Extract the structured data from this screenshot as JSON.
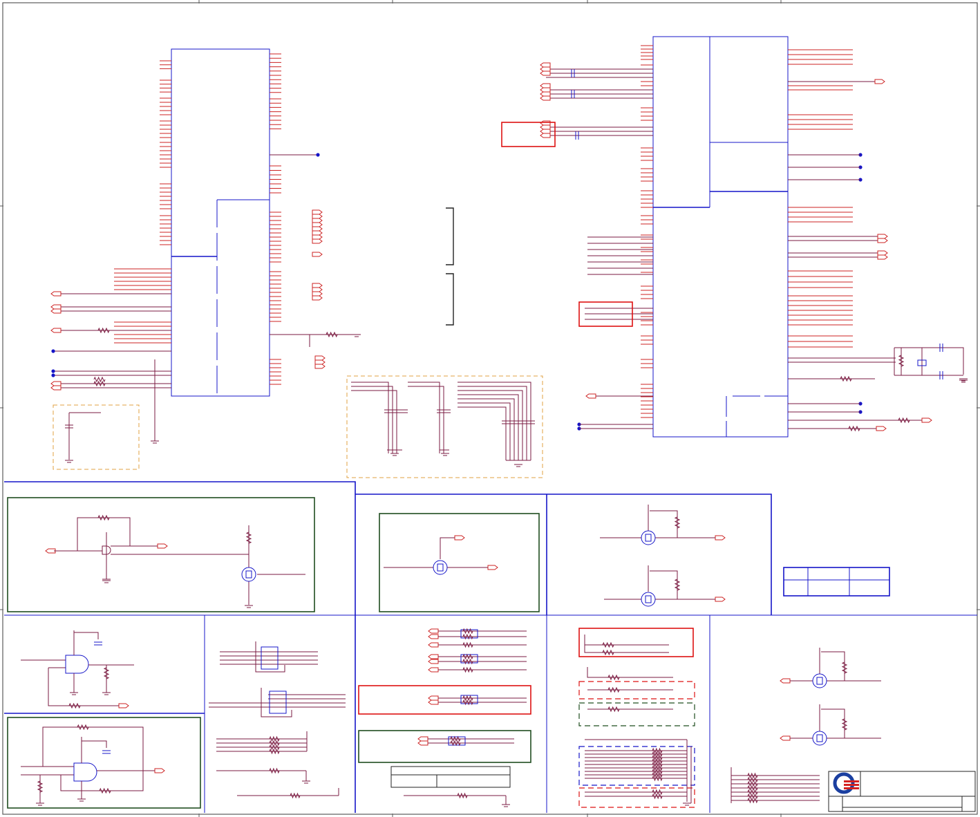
{
  "colors": {
    "border": "#5a5a5a",
    "wire": "#7a1a40",
    "pin": "#cc2222",
    "blue": "#1414c8",
    "green": "#1f4d1f",
    "red": "#dd1111",
    "orange": "#e0a040",
    "dot": "#1414c8",
    "logo_blue": "#1b3fa0",
    "logo_red": "#d42020"
  }
}
